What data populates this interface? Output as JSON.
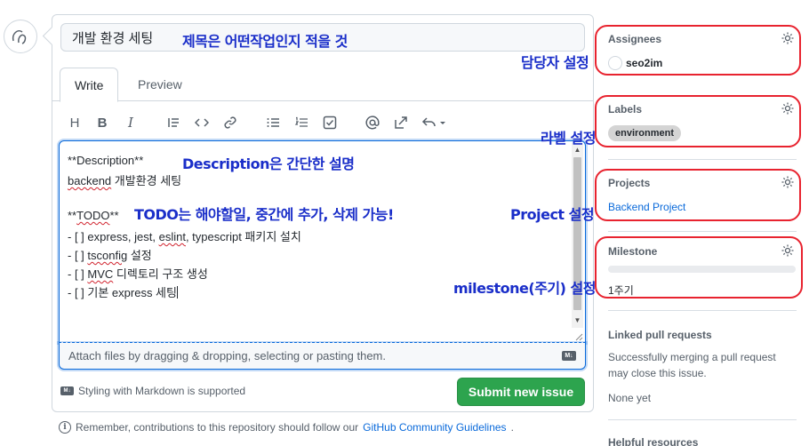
{
  "issue": {
    "title_value": "개발 환경 세팅",
    "tabs": {
      "write": "Write",
      "preview": "Preview"
    },
    "body_lines": {
      "l1": "**Description**",
      "l2_a": "backend",
      "l2_b": " 개발환경 세팅",
      "l3_a": "**",
      "l3_b": "TODO",
      "l3_c": "**",
      "l4_a": "- [ ] express, jest, ",
      "l4_b": "eslint",
      "l4_c": ", typescript 패키지 설치",
      "l5_a": "- [ ] ",
      "l5_b": "tsconfig",
      "l5_c": " 설정",
      "l6_a": "- [ ] ",
      "l6_b": "MVC",
      "l6_c": " 디렉토리 구조 생성",
      "l7": "- [ ] 기본 express 세팅"
    },
    "attach_hint": "Attach files by dragging & dropping, selecting or pasting them.",
    "md_supported": "Styling with Markdown is supported",
    "submit_label": "Submit new issue",
    "remember_text": "Remember, contributions to this repository should follow our ",
    "guidelines_link": "GitHub Community Guidelines",
    "remember_end": "."
  },
  "toolbar": {
    "icons": [
      "heading-icon",
      "bold-icon",
      "italic-icon",
      "quote-icon",
      "code-icon",
      "link-icon",
      "unordered-list-icon",
      "ordered-list-icon",
      "task-list-icon",
      "mention-icon",
      "reference-icon",
      "reply-icon"
    ],
    "heading": "H",
    "bold": "B",
    "italic": "I"
  },
  "annotations": {
    "title_note": "제목은 어떤작업인지 적을 것",
    "description_note": "Description은 간단한 설명",
    "todo_note": "TODO는 해야할일, 중간에 추가, 삭제 가능!",
    "assignee_note": "담당자 설정",
    "label_note": "라벨 설정",
    "project_note": "Project 설정",
    "milestone_note": "milestone(주기) 설정"
  },
  "sidebar": {
    "assignees": {
      "heading": "Assignees",
      "user": "seo2im"
    },
    "labels": {
      "heading": "Labels",
      "label": "environment"
    },
    "projects": {
      "heading": "Projects",
      "project": "Backend Project"
    },
    "milestone": {
      "heading": "Milestone",
      "name": "1주기",
      "progress": 0
    },
    "linked_prs": {
      "heading": "Linked pull requests",
      "desc": "Successfully merging a pull request may close this issue.",
      "none": "None yet"
    },
    "helpful": {
      "heading": "Helpful resources"
    }
  },
  "colors": {
    "accent": "#0969da",
    "submit": "#2da44e",
    "annotation": "#1a2ec9",
    "ring": "#e8232f"
  }
}
